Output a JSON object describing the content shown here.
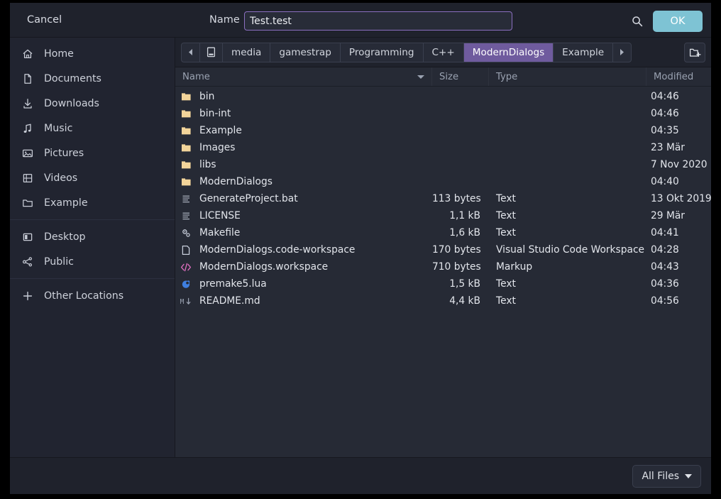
{
  "header": {
    "cancel_label": "Cancel",
    "name_label": "Name",
    "filename_value": "Test.test",
    "filename_placeholder": "",
    "ok_label": "OK",
    "search_icon": "search-icon",
    "accent_ok_color": "#7ec3d4"
  },
  "sidebar": {
    "groups": [
      {
        "items": [
          {
            "label": "Home",
            "icon": "home-icon"
          },
          {
            "label": "Documents",
            "icon": "document-icon"
          },
          {
            "label": "Downloads",
            "icon": "download-icon"
          },
          {
            "label": "Music",
            "icon": "music-note-icon"
          },
          {
            "label": "Pictures",
            "icon": "image-icon"
          },
          {
            "label": "Videos",
            "icon": "film-icon"
          },
          {
            "label": "Example",
            "icon": "folder-outline-icon"
          }
        ]
      },
      {
        "items": [
          {
            "label": "Desktop",
            "icon": "monitor-icon"
          },
          {
            "label": "Public",
            "icon": "share-network-icon"
          }
        ]
      },
      {
        "items": [
          {
            "label": "Other Locations",
            "icon": "plus-icon"
          }
        ]
      }
    ]
  },
  "pathbar": {
    "back_icon": "chevron-left-icon",
    "forward_icon": "chevron-right-icon",
    "device_icon": "drive-icon",
    "new_folder_icon": "new-folder-icon",
    "crumbs": [
      {
        "label": "media",
        "active": false
      },
      {
        "label": "gamestrap",
        "active": false
      },
      {
        "label": "Programming",
        "active": false
      },
      {
        "label": "C++",
        "active": false
      },
      {
        "label": "ModernDialogs",
        "active": true
      },
      {
        "label": "Example",
        "active": false
      }
    ],
    "active_color": "#6f5b9e"
  },
  "columns": {
    "name": "Name",
    "size": "Size",
    "type": "Type",
    "modified": "Modified",
    "sorted_by": "Name",
    "sort_direction": "descending"
  },
  "files": [
    {
      "name": "bin",
      "icon": "folder-icon",
      "size": "",
      "type": "",
      "modified": "04:46"
    },
    {
      "name": "bin-int",
      "icon": "folder-icon",
      "size": "",
      "type": "",
      "modified": "04:46"
    },
    {
      "name": "Example",
      "icon": "folder-icon",
      "size": "",
      "type": "",
      "modified": "04:35"
    },
    {
      "name": "Images",
      "icon": "folder-icon",
      "size": "",
      "type": "",
      "modified": "23 Mär"
    },
    {
      "name": "libs",
      "icon": "folder-icon",
      "size": "",
      "type": "",
      "modified": "7 Nov 2020"
    },
    {
      "name": "ModernDialogs",
      "icon": "folder-icon",
      "size": "",
      "type": "",
      "modified": "04:40"
    },
    {
      "name": "GenerateProject.bat",
      "icon": "text-file-icon",
      "size": "113 bytes",
      "type": "Text",
      "modified": "13 Okt 2019"
    },
    {
      "name": "LICENSE",
      "icon": "text-file-icon",
      "size": "1,1 kB",
      "type": "Text",
      "modified": "29 Mär"
    },
    {
      "name": "Makefile",
      "icon": "gears-icon",
      "size": "1,6 kB",
      "type": "Text",
      "modified": "04:41"
    },
    {
      "name": "ModernDialogs.code-workspace",
      "icon": "blank-file-icon",
      "size": "170 bytes",
      "type": "Visual Studio Code Workspace",
      "modified": "04:28"
    },
    {
      "name": "ModernDialogs.workspace",
      "icon": "markup-code-icon",
      "size": "710 bytes",
      "type": "Markup",
      "modified": "04:43"
    },
    {
      "name": "premake5.lua",
      "icon": "lua-moon-icon",
      "size": "1,5 kB",
      "type": "Text",
      "modified": "04:36"
    },
    {
      "name": "README.md",
      "icon": "markdown-icon",
      "size": "4,4 kB",
      "type": "Text",
      "modified": "04:56"
    }
  ],
  "footer": {
    "filter_label": "All Files",
    "filter_caret_icon": "chevron-down-icon"
  }
}
